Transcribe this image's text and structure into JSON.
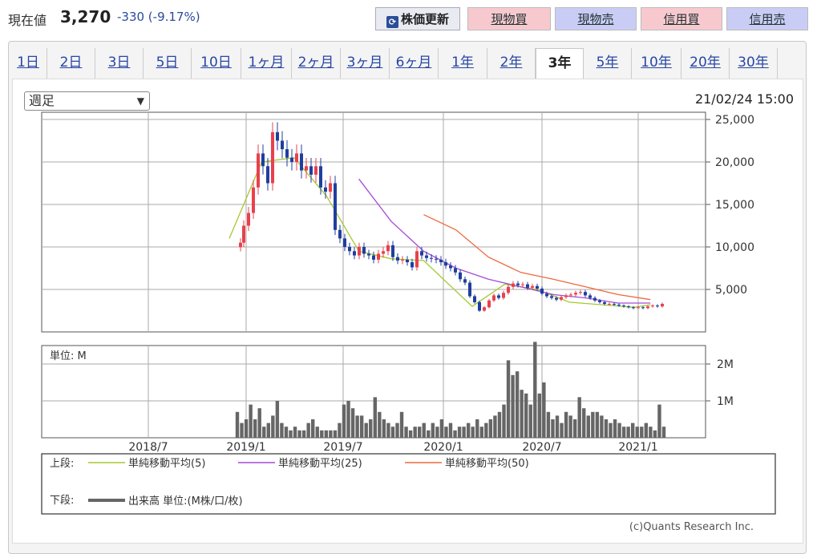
{
  "header": {
    "price_label": "現在値",
    "price": "3,270",
    "change": "-330 (-9.17%)",
    "refresh_label": "株価更新",
    "buttons": [
      {
        "label": "現物買",
        "kind": "pink"
      },
      {
        "label": "現物売",
        "kind": "lav"
      },
      {
        "label": "信用買",
        "kind": "pink"
      },
      {
        "label": "信用売",
        "kind": "lav"
      }
    ]
  },
  "tabs": [
    {
      "label": "1日"
    },
    {
      "label": "2日"
    },
    {
      "label": "3日"
    },
    {
      "label": "5日"
    },
    {
      "label": "10日"
    },
    {
      "label": "1ヶ月"
    },
    {
      "label": "2ヶ月"
    },
    {
      "label": "3ヶ月"
    },
    {
      "label": "6ヶ月"
    },
    {
      "label": "1年"
    },
    {
      "label": "2年"
    },
    {
      "label": "3年"
    },
    {
      "label": "5年"
    },
    {
      "label": "10年"
    },
    {
      "label": "20年"
    },
    {
      "label": "30年"
    }
  ],
  "active_tab": "3年",
  "interval_select": "週足",
  "timestamp": "21/02/24 15:00",
  "copyright": "(c)Quants Research Inc.",
  "colors": {
    "up": "#e8414d",
    "down": "#1f3f9e",
    "ma5": "#a6c832",
    "ma25": "#a64ad6",
    "ma50": "#ee6a3e",
    "volume": "#666666",
    "grid": "#aaaaaa"
  },
  "chart_data": [
    {
      "type": "line",
      "title": "",
      "x": [
        "2018/7",
        "2019/1",
        "2019/7",
        "2020/1",
        "2020/7",
        "2021/1"
      ],
      "ylim": [
        0,
        25000
      ],
      "yticks": [
        "25,000",
        "20,000",
        "15,000",
        "10,000",
        "5,000"
      ],
      "series": [
        {
          "name": "単純移動平均(5)",
          "dates": [
            "2018/12",
            "2019/2",
            "2019/4",
            "2019/6",
            "2019/8",
            "2019/10",
            "2019/12",
            "2020/3",
            "2020/5",
            "2020/7",
            "2020/9",
            "2020/11",
            "2021/1",
            "2021/2"
          ],
          "values": [
            11000,
            20000,
            20500,
            16000,
            9500,
            8600,
            8400,
            3000,
            5600,
            5000,
            3500,
            3200,
            2900,
            3200
          ]
        },
        {
          "name": "単純移動平均(25)",
          "dates": [
            "2019/8",
            "2019/10",
            "2019/12",
            "2020/2",
            "2020/4",
            "2020/6",
            "2020/8",
            "2020/10",
            "2020/12",
            "2021/2"
          ],
          "values": [
            18000,
            13000,
            9500,
            7500,
            6200,
            5300,
            4400,
            4000,
            3400,
            3400
          ]
        },
        {
          "name": "単純移動平均(50)",
          "dates": [
            "2019/12",
            "2020/2",
            "2020/4",
            "2020/6",
            "2020/8",
            "2020/10",
            "2020/12",
            "2021/2"
          ],
          "values": [
            13800,
            12000,
            8800,
            7000,
            6200,
            5300,
            4400,
            3800
          ]
        }
      ]
    },
    {
      "type": "bar",
      "title": "単位: M",
      "ylim": [
        0,
        2500000
      ],
      "yticks": [
        "2M",
        "1M"
      ],
      "series": [
        {
          "name": "出来高",
          "values": [
            700000,
            400000,
            500000,
            900000,
            500000,
            800000,
            300000,
            400000,
            600000,
            1000000,
            400000,
            300000,
            200000,
            300000,
            200000,
            200000,
            400000,
            500000,
            300000,
            200000,
            200000,
            200000,
            200000,
            400000,
            900000,
            1000000,
            800000,
            600000,
            600000,
            400000,
            500000,
            1100000,
            700000,
            500000,
            400000,
            300000,
            400000,
            700000,
            300000,
            200000,
            300000,
            300000,
            400000,
            200000,
            400000,
            300000,
            500000,
            300000,
            400000,
            200000,
            300000,
            300000,
            400000,
            300000,
            500000,
            300000,
            400000,
            500000,
            600000,
            700000,
            900000,
            2100000,
            1700000,
            1800000,
            1300000,
            1200000,
            900000,
            2600000,
            1200000,
            1500000,
            700000,
            500000,
            600000,
            400000,
            700000,
            600000,
            500000,
            1100000,
            800000,
            600000,
            700000,
            700000,
            600000,
            500000,
            400000,
            500000,
            400000,
            300000,
            300000,
            400000,
            300000,
            300000,
            400000,
            300000,
            200000,
            900000,
            300000
          ]
        }
      ]
    }
  ],
  "legend": {
    "upper_label": "上段:",
    "lower_label": "下段:",
    "ma5": "単純移動平均(5)",
    "ma25": "単純移動平均(25)",
    "ma50": "単純移動平均(50)",
    "volume": "出来高 単位:(M株/口/枚)"
  }
}
